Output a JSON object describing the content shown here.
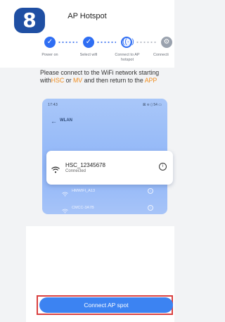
{
  "header": {
    "step_number": "8",
    "title": "AP Hotspot"
  },
  "stepper": {
    "steps": [
      {
        "label": "Power on",
        "state": "done",
        "icon": "check-icon"
      },
      {
        "label": "Select wifi",
        "state": "done",
        "icon": "check-icon"
      },
      {
        "label": "Connect to AP hotspot",
        "state": "current",
        "icon": "hotspot-icon"
      },
      {
        "label": "Connecti",
        "state": "pending",
        "icon": "gear-icon"
      }
    ]
  },
  "instruction": {
    "text_before": "Please connect to the WiFi network starting with",
    "prefix1": "HSC",
    "or": " or ",
    "prefix2": "MV",
    "text_middle": " and then return to the ",
    "app": "APP"
  },
  "phone": {
    "time": "17:43",
    "status": "⊠ ≋ ▯ 54 ▭",
    "screen_title": "WLAN",
    "connected_network": {
      "ssid": "HSC_12345678",
      "status": "Connected"
    },
    "other_networks": [
      {
        "ssid": "HMWIFI_A13"
      },
      {
        "ssid": "CMCC-3A7B"
      }
    ]
  },
  "footer": {
    "connect_button_label": "Connect AP spot"
  },
  "colors": {
    "accent": "#2f6ef3",
    "badge": "#1f4fa3",
    "highlight": "#f08c1c",
    "button": "#3c83f2",
    "annotation": "#d94040"
  }
}
